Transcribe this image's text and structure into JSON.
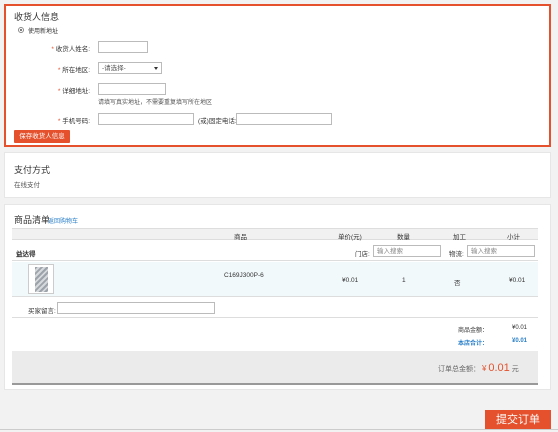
{
  "consignee": {
    "title": "收货人信息",
    "use_new_address": "使用新地址",
    "required_mark": "*",
    "name_label": "收货人姓名:",
    "region_label": "所在地区:",
    "region_placeholder": "-请选择-",
    "detail_label": "详细地址:",
    "detail_hint": "请填写真实地址，不需要重复填写所在地区",
    "phone_label": "手机号码:",
    "tel_label": "(或)固定电话:",
    "save_button": "保存收货人信息"
  },
  "payment": {
    "title": "支付方式",
    "method": "在线支付"
  },
  "order": {
    "title": "商品清单",
    "back_link": "返回购物车",
    "columns": {
      "product": "商品",
      "unit_price": "单价(元)",
      "quantity": "数量",
      "processing": "加工",
      "subtotal": "小计"
    },
    "shop_name": "益达得",
    "store_label": "门店:",
    "store_placeholder": "输入搜索",
    "logistics_label": "物流:",
    "logistics_placeholder": "输入搜索",
    "item": {
      "code": "C169J300P-6",
      "unit_price": "¥0.01",
      "quantity": "1",
      "processing": "否",
      "subtotal": "¥0.01"
    },
    "buyer_message_label": "买家留言:",
    "goods_amount_label": "商品金额：",
    "goods_amount": "¥0.01",
    "shop_total_label": "本店合计：",
    "shop_total": "¥0.01",
    "grand_total_label": "订单总金额：",
    "currency": "¥",
    "grand_total_value": "0.01",
    "grand_total_unit": "元"
  },
  "submit_button": "提交订单"
}
